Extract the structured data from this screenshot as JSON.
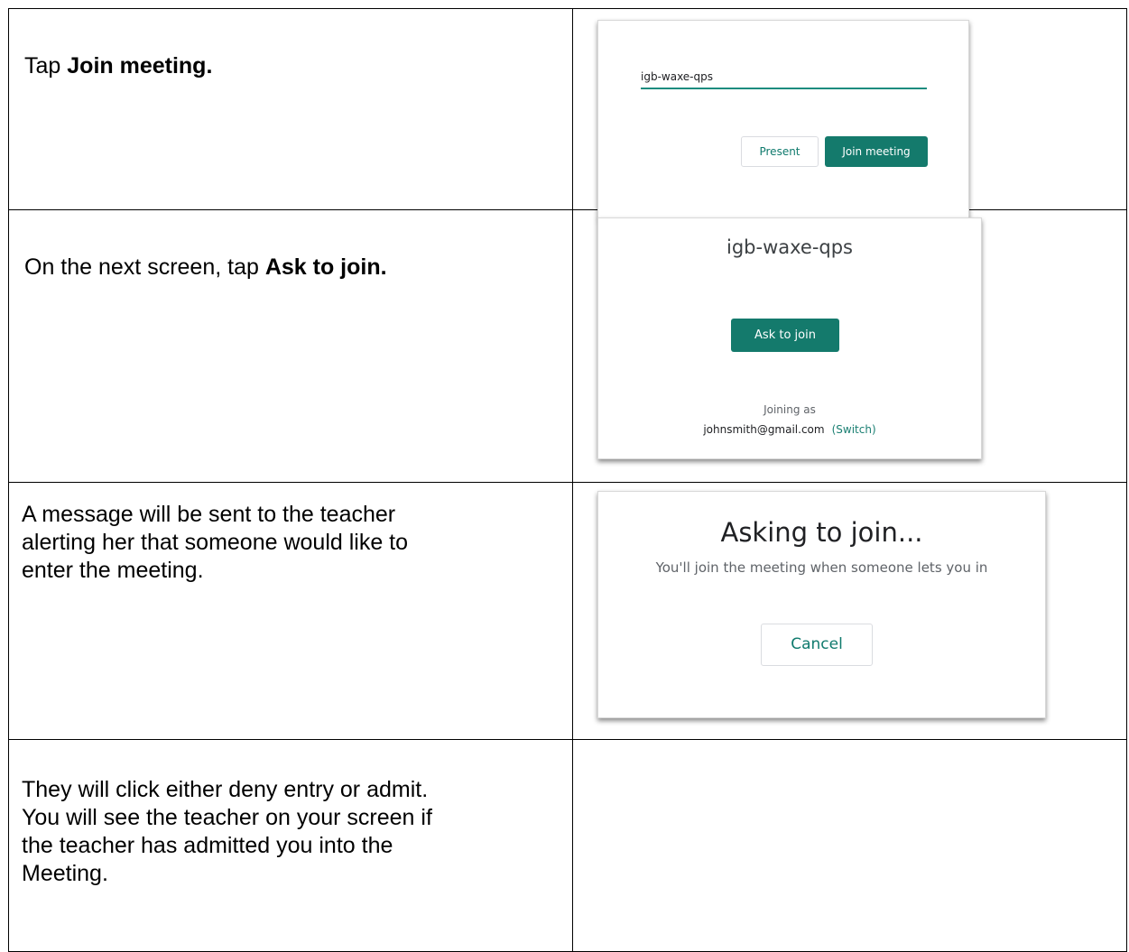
{
  "steps": [
    {
      "text_plain": "Tap ",
      "text_bold": "Join meeting."
    },
    {
      "text_plain": "On the next screen, tap ",
      "text_bold": "Ask to join."
    },
    {
      "text_plain": "A message will be sent to the teacher alerting her that someone would like to enter the meeting.",
      "text_bold": ""
    },
    {
      "text_plain": "They will click either deny entry or admit. You will see the teacher on your screen if the teacher has admitted you into the Meeting.",
      "text_bold": ""
    }
  ],
  "screen1": {
    "meeting_code": "igb-waxe-qps",
    "present_label": "Present",
    "join_label": "Join meeting"
  },
  "screen2": {
    "title": "igb-waxe-qps",
    "ask_label": "Ask to join",
    "joining_as": "Joining as",
    "account": "johnsmith@gmail.com",
    "switch_label": "(Switch)"
  },
  "screen3": {
    "title": "Asking to join...",
    "subtitle": "You'll join the meeting when someone lets you in",
    "cancel_label": "Cancel"
  },
  "colors": {
    "accent": "#147a6c",
    "accent_text": "#0f7a6d",
    "underline": "#1d8c7f"
  }
}
